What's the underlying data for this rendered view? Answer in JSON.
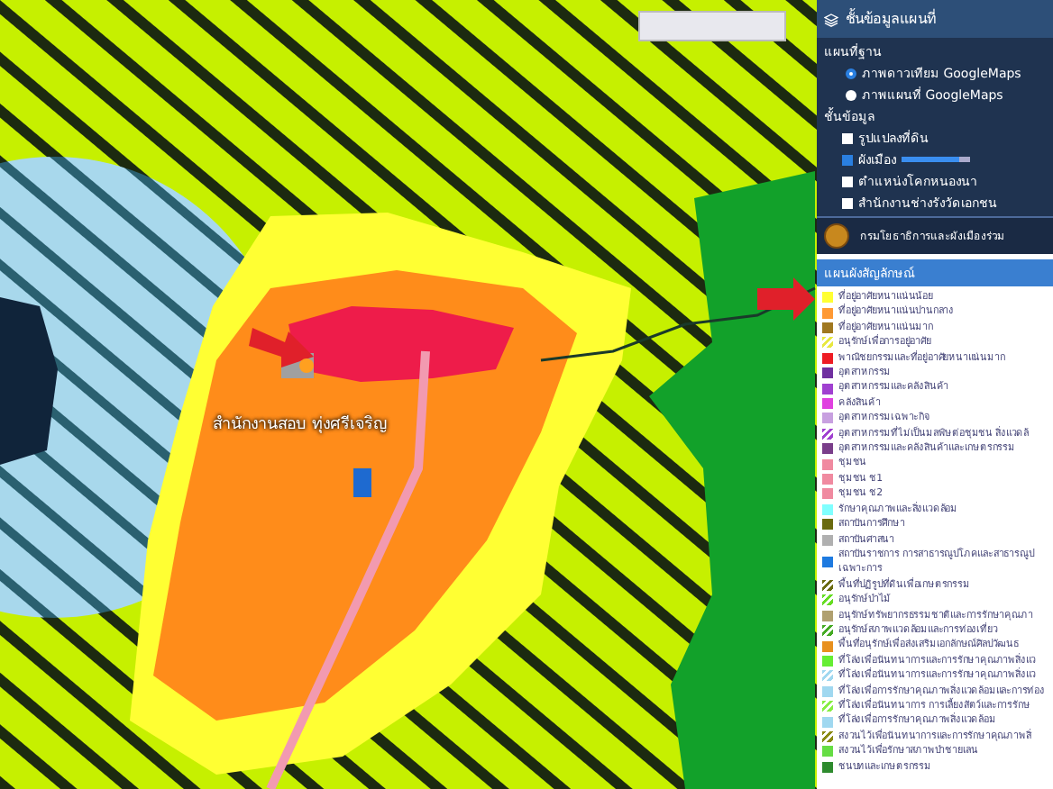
{
  "map": {
    "place_label": "สำนักงานสอบ ทุ่งศรีเจริญ"
  },
  "layer_panel": {
    "title": "ชั้นข้อมูลแผนที่",
    "basemap_heading": "แผนที่ฐาน",
    "basemaps": [
      {
        "label": "ภาพดาวเทียม GoogleMaps",
        "selected": true
      },
      {
        "label": "ภาพแผนที่ GoogleMaps",
        "selected": false
      }
    ],
    "layers_heading": "ชั้นข้อมูล",
    "layers": [
      {
        "label": "รูปแปลงที่ดิน",
        "checked": false
      },
      {
        "label": "ผังเมือง",
        "checked": true,
        "level": 0.85
      },
      {
        "label": "ตำแหน่งโคกหนองนา",
        "checked": false
      },
      {
        "label": "สำนักงานช่างรังวัดเอกชน",
        "checked": false
      }
    ],
    "agency": "กรมโยธาธิการและผังเมืองร่วม"
  },
  "legend": {
    "title": "แผนผังสัญลักษณ์",
    "items": [
      {
        "label": "ที่อยู่อาศัยหนาแน่นน้อย",
        "color": "#ffff33",
        "kind": "solid"
      },
      {
        "label": "ที่อยู่อาศัยหนาแน่นปานกลาง",
        "color": "#ff9933",
        "kind": "solid"
      },
      {
        "label": "ที่อยู่อาศัยหนาแน่นมาก",
        "color": "#a07820",
        "kind": "solid"
      },
      {
        "label": "อนุรักษ์เพื่อการอยู่อาศัย",
        "color": "#e8e840",
        "kind": "hatch"
      },
      {
        "label": "พาณิชยกรรมและที่อยู่อาศัยหนาแน่นมาก",
        "color": "#ee1c24",
        "kind": "solid"
      },
      {
        "label": "อุตสาหกรรม",
        "color": "#7030a0",
        "kind": "solid"
      },
      {
        "label": "อุตสาหกรรมและคลังสินค้า",
        "color": "#a040d0",
        "kind": "solid"
      },
      {
        "label": "คลังสินค้า",
        "color": "#e040e0",
        "kind": "solid"
      },
      {
        "label": "อุตสาหกรรมเฉพาะกิจ",
        "color": "#c8a0e0",
        "kind": "solid"
      },
      {
        "label": "อุตสาหกรรมที่ไม่เป็นมลพิษต่อชุมชน สิ่งแวดล้",
        "color": "#a040d0",
        "kind": "hatch"
      },
      {
        "label": "อุตสาหกรรมและคลังสินค้าและเกษตรกรรม",
        "color": "#7a3e8a",
        "kind": "solid"
      },
      {
        "label": "ชุมชน",
        "color": "#f08aa0",
        "kind": "solid"
      },
      {
        "label": "ชุมชน ช1",
        "color": "#f08aa0",
        "kind": "solid"
      },
      {
        "label": "ชุมชน ช2",
        "color": "#f08aa0",
        "kind": "solid"
      },
      {
        "label": "รักษาคุณภาพและสิ่งแวดล้อม",
        "color": "#80ffff",
        "kind": "solid"
      },
      {
        "label": "สถาบันการศึกษา",
        "color": "#6b6b10",
        "kind": "solid"
      },
      {
        "label": "สถาบันศาสนา",
        "color": "#b0b0b0",
        "kind": "solid"
      },
      {
        "label": "สถาบันราชการ การสาธารณูปโภคและสาธารณูป เฉพาะการ",
        "color": "#1e7ae0",
        "kind": "solid"
      },
      {
        "label": "พื้นที่ปฏิรูปที่ดินเพื่อเกษตรกรรม",
        "color": "#6b6b10",
        "kind": "hatch"
      },
      {
        "label": "อนุรักษ์ป่าไม้",
        "color": "#66dd22",
        "kind": "hatch"
      },
      {
        "label": "อนุรักษ์ทรัพยากรธรรมชาติและการรักษาคุณภา",
        "color": "#b0a070",
        "kind": "solid"
      },
      {
        "label": "อนุรักษ์สภาพแวดล้อมและการท่องเที่ยว",
        "color": "#44aa22",
        "kind": "hatch"
      },
      {
        "label": "พื้นที่อนุรักษ์เพื่อส่งเสริมเอกลักษณ์ศิลปวัฒนธ",
        "color": "#e8901e",
        "kind": "solid"
      },
      {
        "label": "ที่โล่งเพื่อนันทนาการและการรักษาคุณภาพสิ่งแว",
        "color": "#66ee33",
        "kind": "solid"
      },
      {
        "label": "ที่โล่งเพื่อนันทนาการและการรักษาคุณภาพสิ่งแว",
        "color": "#a0d8f0",
        "kind": "hatch"
      },
      {
        "label": "ที่โล่งเพื่อการรักษาคุณภาพสิ่งแวดล้อมและการท่อง",
        "color": "#a0d8f0",
        "kind": "solid"
      },
      {
        "label": "ที่โล่งเพื่อนันทนาการ การเลี้ยงสัตว์และการรักษ",
        "color": "#88ee44",
        "kind": "hatch"
      },
      {
        "label": "ที่โล่งเพื่อการรักษาคุณภาพสิ่งแวดล้อม",
        "color": "#a0d8f0",
        "kind": "solid"
      },
      {
        "label": "สงวนไว้เพื่อนันทนาการและการรักษาคุณภาพสิ่",
        "color": "#8a8a10",
        "kind": "hatch"
      },
      {
        "label": "สงวนไว้เพื่อรักษาสภาพป่าชายเลน",
        "color": "#66dd44",
        "kind": "solid"
      },
      {
        "label": "ชนบทและเกษตรกรรม",
        "color": "#2e8b2e",
        "kind": "solid"
      }
    ]
  }
}
